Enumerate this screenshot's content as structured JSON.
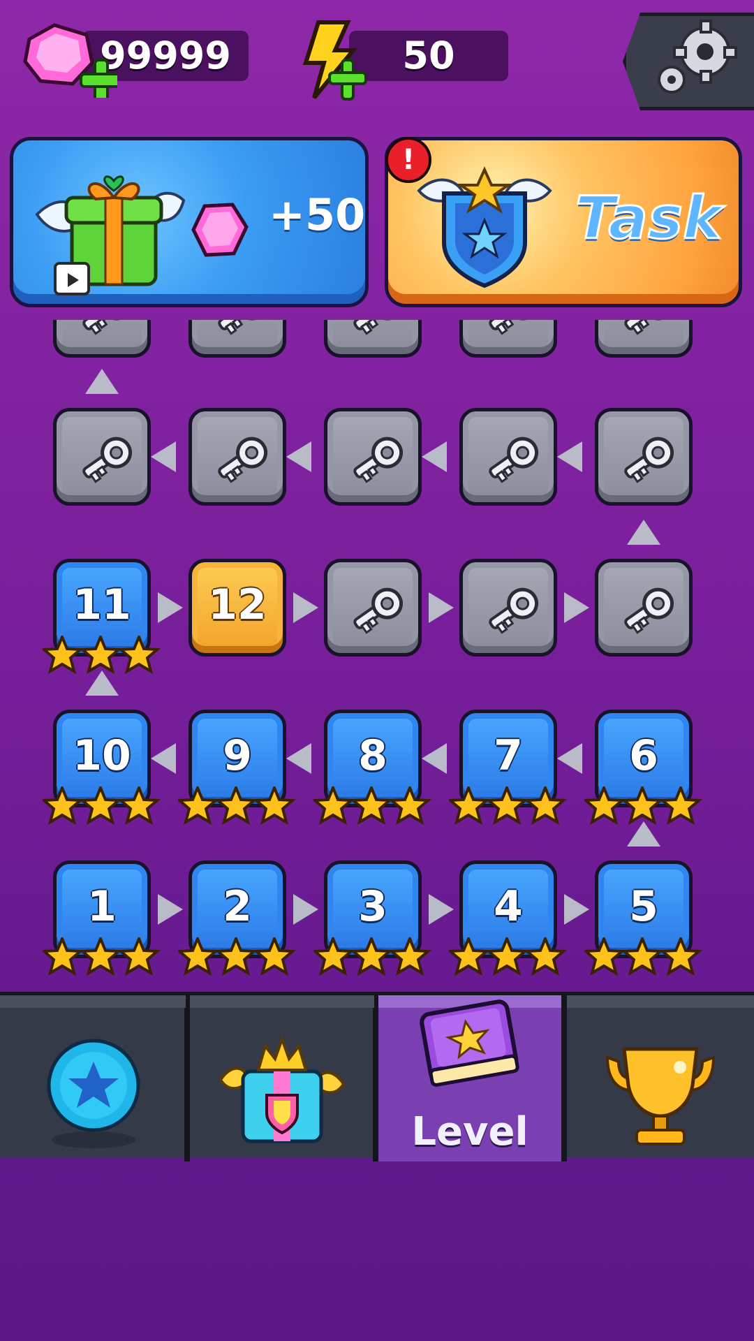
{
  "currency": {
    "gems": "99999",
    "energy": "50"
  },
  "banners": {
    "reward": {
      "amount": "+50"
    },
    "task": {
      "label": "Task",
      "alert": "!"
    }
  },
  "levels": {
    "completed": [
      {
        "number": "1",
        "stars": 3
      },
      {
        "number": "2",
        "stars": 3
      },
      {
        "number": "3",
        "stars": 3
      },
      {
        "number": "4",
        "stars": 3
      },
      {
        "number": "5",
        "stars": 3
      },
      {
        "number": "6",
        "stars": 3
      },
      {
        "number": "7",
        "stars": 3
      },
      {
        "number": "8",
        "stars": 3
      },
      {
        "number": "9",
        "stars": 3
      },
      {
        "number": "10",
        "stars": 3
      },
      {
        "number": "11",
        "stars": 3
      }
    ],
    "current": "12"
  },
  "nav": {
    "tabs": [
      "home-orb",
      "gift-shop",
      "level",
      "trophy"
    ],
    "active_label": "Level"
  },
  "colors": {
    "background": "#7a1f9c",
    "completed_tile": "#3a8ef0",
    "current_tile": "#f5b53a",
    "locked_tile": "#9a9cab",
    "nav_bar": "#353a48",
    "active_tab": "#7a3fb0"
  }
}
